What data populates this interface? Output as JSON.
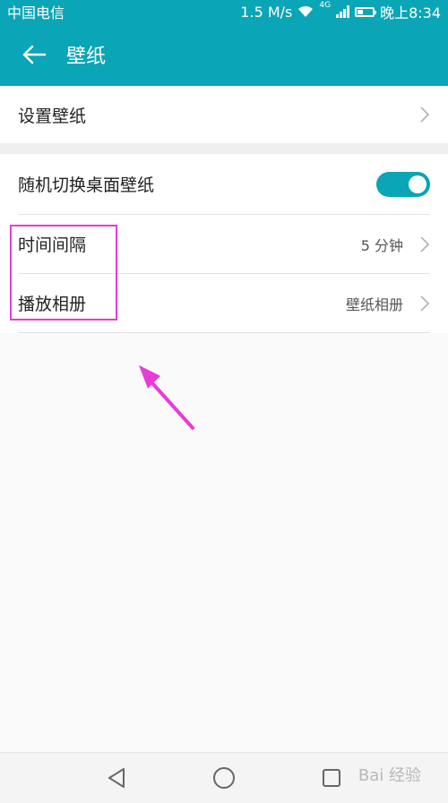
{
  "status_bar": {
    "carrier": "中国电信",
    "speed": "1.5 M/s",
    "network": "4G",
    "time": "晚上8:34",
    "battery_level": 0.4
  },
  "app_bar": {
    "title": "壁纸",
    "back_icon": "arrow-left-icon"
  },
  "settings": {
    "set_wallpaper": "设置壁纸",
    "random_switch": {
      "label": "随机切换桌面壁纸",
      "enabled": true
    },
    "interval": {
      "label": "时间间隔",
      "value": "5 分钟"
    },
    "album": {
      "label": "播放相册",
      "value": "壁纸相册"
    }
  },
  "nav": {
    "back": "triangle-back-icon",
    "home": "circle-home-icon",
    "recents": "square-recents-icon"
  },
  "watermark": "Bai 经验",
  "colors": {
    "accent": "#0aa5b6",
    "annotation": "#e93bd8"
  }
}
